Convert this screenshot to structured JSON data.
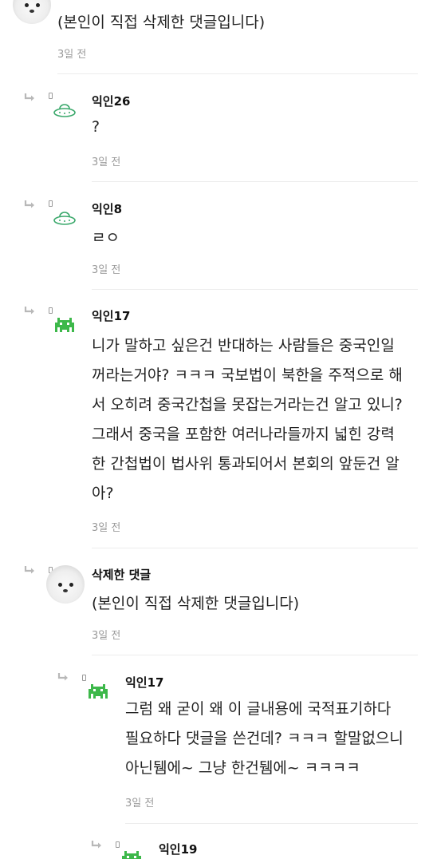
{
  "comments": [
    {
      "nickname": "",
      "body": "(본인이 직접 삭제한 댓글입니다)",
      "time": "3일 전",
      "avatar": "dog-photo-avatar"
    },
    {
      "nickname": "익인26",
      "body": "?",
      "time": "3일 전",
      "avatar": "ufo-icon"
    },
    {
      "nickname": "익인8",
      "body": "ㄹㅇ",
      "time": "3일 전",
      "avatar": "ufo-icon"
    },
    {
      "nickname": "익인17",
      "body_lines": [
        "니가 말하고 싶은건 반대하는 사람들은 중국인일",
        "꺼라는거야? ㅋㅋㅋ 국보법이 북한을 주적으로 해",
        "서 오히려 중국간첩을 못잡는거라는건 알고 있니?",
        "그래서 중국을 포함한 여러나라들까지 넓힌 강력",
        "한 간첩법이 법사위 통과되어서 본회의 앞둔건 알",
        "아?"
      ],
      "time": "3일 전",
      "avatar": "space-invader-icon"
    },
    {
      "nickname": "삭제한 댓글",
      "body": "(본인이 직접 삭제한 댓글입니다)",
      "time": "3일 전",
      "avatar": "dog-photo-avatar"
    },
    {
      "nickname": "익인17",
      "body_lines": [
        "그럼 왜 굳이 왜 이 글내용에 국적표기하다",
        "필요하다 댓글을 쓴건데? ㅋㅋㅋ 할말없으니",
        "아닌뒘에~ 그냥 한건뒘에~ ㅋㅋㅋㅋ"
      ],
      "time": "3일 전",
      "avatar": "space-invader-icon"
    },
    {
      "nickname": "익인19",
      "avatar": "space-invader-icon"
    }
  ],
  "colors": {
    "ufo": "#3aa86b",
    "invader": "#3db84a",
    "arrow": "#b8b8b8",
    "time": "#9a9a9a",
    "divider": "#ececec"
  }
}
